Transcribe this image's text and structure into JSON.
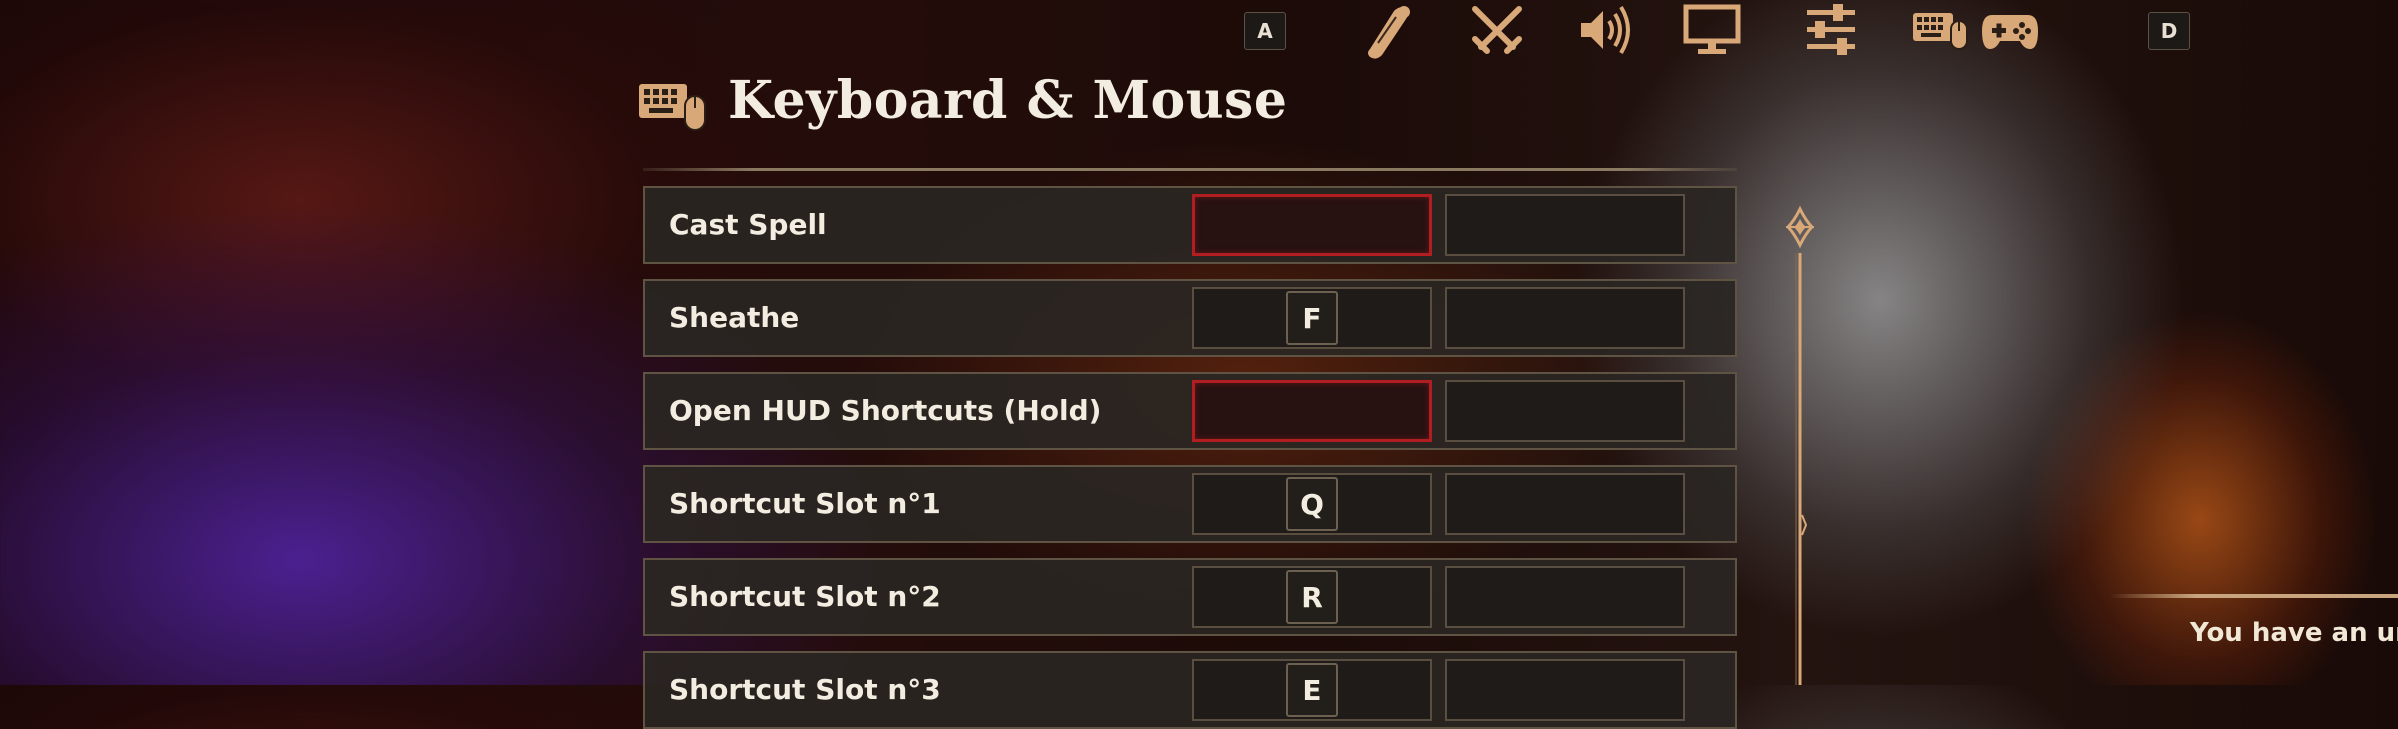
{
  "nav": {
    "prev_key": "A",
    "next_key": "D",
    "tabs": [
      {
        "icon": "scroll-icon",
        "active": false
      },
      {
        "icon": "crossed-swords-icon",
        "active": false
      },
      {
        "icon": "speaker-icon",
        "active": false
      },
      {
        "icon": "monitor-icon",
        "active": false
      },
      {
        "icon": "sliders-icon",
        "active": false
      },
      {
        "icon": "keyboard-mouse-icon",
        "active": true
      },
      {
        "icon": "gamepad-icon",
        "active": false
      }
    ]
  },
  "header": {
    "icon": "keyboard-mouse-icon",
    "title": "Keyboard & Mouse"
  },
  "bindings": [
    {
      "action": "Cast Spell",
      "primary": "",
      "secondary": "",
      "primary_unassigned": true
    },
    {
      "action": "Sheathe",
      "primary": "F",
      "secondary": "",
      "primary_unassigned": false
    },
    {
      "action": "Open HUD Shortcuts (Hold)",
      "primary": "",
      "secondary": "",
      "primary_unassigned": true
    },
    {
      "action": "Shortcut Slot n°1",
      "primary": "Q",
      "secondary": "",
      "primary_unassigned": false
    },
    {
      "action": "Shortcut Slot n°2",
      "primary": "R",
      "secondary": "",
      "primary_unassigned": false
    },
    {
      "action": "Shortcut Slot n°3",
      "primary": "E",
      "secondary": "",
      "primary_unassigned": false
    }
  ],
  "notice": {
    "text": "You have an unas"
  },
  "colors": {
    "accent": "#d9a878",
    "unassigned_border": "#b21d22",
    "row_background": "#2a2622",
    "text": "#f2ece1"
  }
}
